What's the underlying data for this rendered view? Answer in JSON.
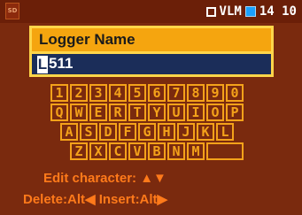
{
  "status_bar": {
    "sd_label": "SD",
    "mode": "VLM",
    "time": "14 10"
  },
  "dialog": {
    "title": "Logger Name",
    "name_first_char": "L",
    "name_rest": "511"
  },
  "keyboard": {
    "row1": [
      "1",
      "2",
      "3",
      "4",
      "5",
      "6",
      "7",
      "8",
      "9",
      "0"
    ],
    "row2": [
      "Q",
      "W",
      "E",
      "R",
      "T",
      "Y",
      "U",
      "I",
      "O",
      "P"
    ],
    "row3": [
      "A",
      "S",
      "D",
      "F",
      "G",
      "H",
      "J",
      "K",
      "L"
    ],
    "row4": [
      "Z",
      "X",
      "C",
      "V",
      "B",
      "N",
      "M"
    ]
  },
  "hints": {
    "edit_character": "Edit character: ▲▼",
    "delete_insert": "Delete:Alt◀ Insert:Alt▶"
  },
  "colors": {
    "background": "#7a2a0e",
    "accent": "#f4a21a",
    "hint": "#ff7a1a",
    "field": "#1b2d59"
  }
}
